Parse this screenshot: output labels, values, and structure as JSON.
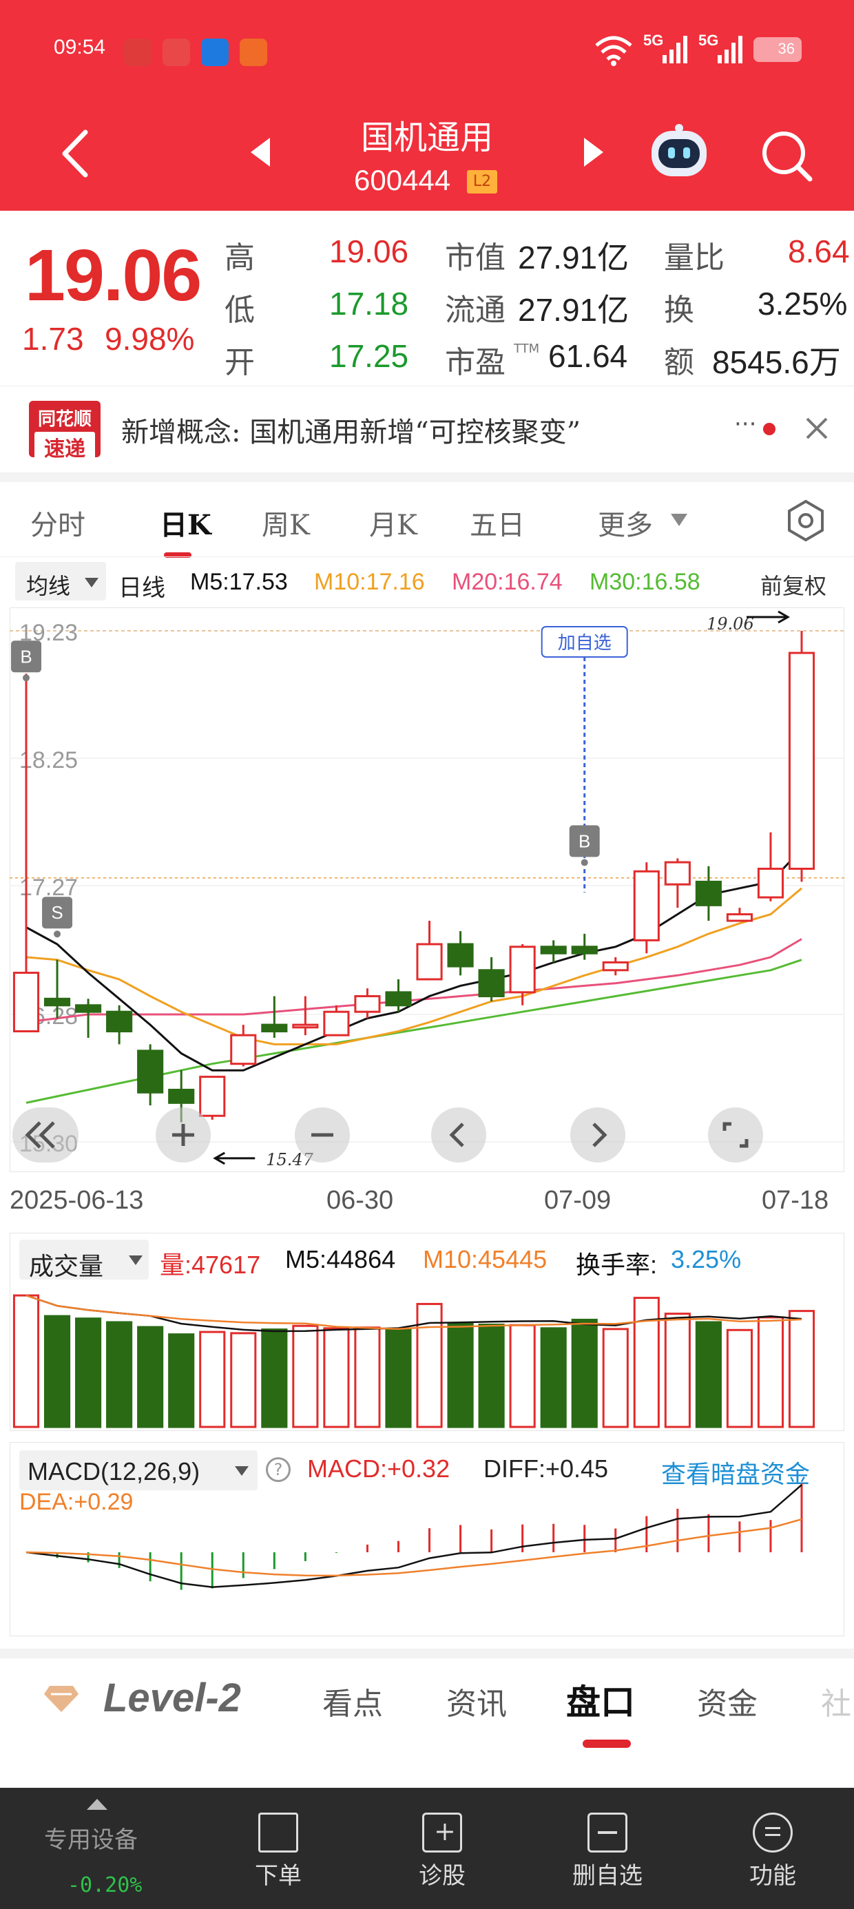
{
  "status_bar": {
    "time": "09:54",
    "network_1": "5G",
    "network_2": "5G",
    "battery": "36"
  },
  "header": {
    "title": "国机通用",
    "code": "600444",
    "level_badge": "L2"
  },
  "quote": {
    "price": "19.06",
    "change": "1.73",
    "change_pct": "9.98%",
    "high_label": "高",
    "high": "19.06",
    "low_label": "低",
    "low": "17.18",
    "open_label": "开",
    "open": "17.25",
    "mkt_cap_label": "市值",
    "mkt_cap": "27.91亿",
    "float_cap_label": "流通",
    "float_cap": "27.91亿",
    "pe_label": "市盈",
    "pe_sup": "TTM",
    "pe": "61.64",
    "vol_ratio_label": "量比",
    "vol_ratio": "8.64",
    "turnover_label": "换",
    "turnover": "3.25%",
    "amount_label": "额",
    "amount": "8545.6万"
  },
  "news": {
    "logo_line1": "同花顺",
    "logo_line2": "速递",
    "text": "新增概念:  国机通用新增“可控核聚变”",
    "more": "···"
  },
  "tabs": [
    "分时",
    "日K",
    "周K",
    "月K",
    "五日",
    "更多"
  ],
  "active_tab": "日K",
  "indicators": {
    "ma_select": "均线",
    "period": "日线",
    "m5": "M5:17.53",
    "m10": "M10:17.16",
    "m20": "M20:16.74",
    "m30": "M30:16.58",
    "adjust": "前复权"
  },
  "chart_data": {
    "type": "candlestick",
    "y_labels": [
      "19.23",
      "18.25",
      "17.27",
      "16.28",
      "15.30"
    ],
    "ylim": [
      15.3,
      19.23
    ],
    "x_labels": [
      "2025-06-13",
      "06-30",
      "07-09",
      "07-18"
    ],
    "candles": [
      {
        "o": 16.15,
        "h": 18.9,
        "l": 16.15,
        "c": 16.6,
        "v": 54000
      },
      {
        "o": 16.4,
        "h": 16.7,
        "l": 16.25,
        "c": 16.35,
        "v": 45500
      },
      {
        "o": 16.35,
        "h": 16.4,
        "l": 16.1,
        "c": 16.3,
        "v": 44500
      },
      {
        "o": 16.3,
        "h": 16.35,
        "l": 16.05,
        "c": 16.15,
        "v": 43000
      },
      {
        "o": 16.0,
        "h": 16.05,
        "l": 15.58,
        "c": 15.68,
        "v": 41000
      },
      {
        "o": 15.7,
        "h": 15.85,
        "l": 15.45,
        "c": 15.6,
        "v": 38000
      },
      {
        "o": 15.5,
        "h": 15.8,
        "l": 15.47,
        "c": 15.8,
        "v": 39000
      },
      {
        "o": 15.9,
        "h": 16.2,
        "l": 15.88,
        "c": 16.12,
        "v": 38500
      },
      {
        "o": 16.2,
        "h": 16.42,
        "l": 16.1,
        "c": 16.15,
        "v": 40000
      },
      {
        "o": 16.18,
        "h": 16.42,
        "l": 16.12,
        "c": 16.2,
        "v": 41500
      },
      {
        "o": 16.12,
        "h": 16.35,
        "l": 16.12,
        "c": 16.3,
        "v": 40500
      },
      {
        "o": 16.3,
        "h": 16.48,
        "l": 16.25,
        "c": 16.42,
        "v": 40800
      },
      {
        "o": 16.45,
        "h": 16.55,
        "l": 16.3,
        "c": 16.35,
        "v": 40200
      },
      {
        "o": 16.55,
        "h": 17.0,
        "l": 16.55,
        "c": 16.82,
        "v": 50500
      },
      {
        "o": 16.82,
        "h": 16.92,
        "l": 16.58,
        "c": 16.65,
        "v": 42500
      },
      {
        "o": 16.62,
        "h": 16.72,
        "l": 16.38,
        "c": 16.42,
        "v": 42000
      },
      {
        "o": 16.45,
        "h": 16.82,
        "l": 16.35,
        "c": 16.8,
        "v": 41800
      },
      {
        "o": 16.8,
        "h": 16.85,
        "l": 16.68,
        "c": 16.75,
        "v": 40500
      },
      {
        "o": 16.8,
        "h": 16.9,
        "l": 16.7,
        "c": 16.75,
        "v": 44000
      },
      {
        "o": 16.62,
        "h": 16.72,
        "l": 16.58,
        "c": 16.68,
        "v": 40200
      },
      {
        "o": 16.85,
        "h": 17.45,
        "l": 16.75,
        "c": 17.38,
        "v": 53000
      },
      {
        "o": 17.28,
        "h": 17.48,
        "l": 17.1,
        "c": 17.45,
        "v": 46500
      },
      {
        "o": 17.3,
        "h": 17.42,
        "l": 17.0,
        "c": 17.12,
        "v": 43000
      },
      {
        "o": 17.0,
        "h": 17.1,
        "l": 17.0,
        "c": 17.05,
        "v": 39800
      },
      {
        "o": 17.18,
        "h": 17.68,
        "l": 17.15,
        "c": 17.4,
        "v": 45000
      },
      {
        "o": 17.4,
        "h": 19.23,
        "l": 17.3,
        "c": 19.06,
        "v": 47617
      }
    ],
    "ma5": [
      16.95,
      16.82,
      16.6,
      16.4,
      16.2,
      15.98,
      15.85,
      15.85,
      15.95,
      16.05,
      16.15,
      16.25,
      16.3,
      16.42,
      16.5,
      16.55,
      16.6,
      16.68,
      16.75,
      16.8,
      16.9,
      17.05,
      17.2,
      17.25,
      17.3,
      17.55
    ],
    "ma10": [
      16.72,
      16.7,
      16.62,
      16.55,
      16.42,
      16.3,
      16.2,
      16.1,
      16.05,
      16.05,
      16.05,
      16.1,
      16.15,
      16.22,
      16.3,
      16.38,
      16.42,
      16.5,
      16.58,
      16.65,
      16.72,
      16.8,
      16.9,
      16.98,
      17.05,
      17.25
    ],
    "ma20": [
      16.22,
      16.25,
      16.28,
      16.28,
      16.28,
      16.28,
      16.28,
      16.28,
      16.3,
      16.32,
      16.34,
      16.36,
      16.38,
      16.4,
      16.42,
      16.44,
      16.46,
      16.48,
      16.5,
      16.52,
      16.55,
      16.58,
      16.62,
      16.66,
      16.72,
      16.86
    ],
    "ma30": [
      15.6,
      15.65,
      15.7,
      15.75,
      15.8,
      15.85,
      15.9,
      15.94,
      15.98,
      16.02,
      16.06,
      16.1,
      16.14,
      16.18,
      16.22,
      16.26,
      16.3,
      16.34,
      16.38,
      16.42,
      16.46,
      16.5,
      16.54,
      16.58,
      16.62,
      16.7
    ],
    "high_marker": "19.06",
    "low_marker": "15.47",
    "add_watch_label": "加自选",
    "buy_marker": "B",
    "sell_marker": "S"
  },
  "volume": {
    "label": "成交量",
    "vol": "量:47617",
    "m5": "M5:44864",
    "m10": "M10:45445",
    "turnover_label": "换手率:",
    "turnover": "3.25%"
  },
  "macd": {
    "label": "MACD(12,26,9)",
    "macd": "MACD:+0.32",
    "diff": "DIFF:+0.45",
    "dea": "DEA:+0.29",
    "link": "查看暗盘资金",
    "help": "?"
  },
  "bottom_tabs": {
    "level2": "Level-2",
    "items": [
      "看点",
      "资讯",
      "盘口",
      "资金",
      "社"
    ],
    "active": "盘口"
  },
  "nav": {
    "device_label": "专用设备",
    "device_change": "-0.20%",
    "items": [
      "下单",
      "诊股",
      "删自选",
      "功能"
    ]
  },
  "colors": {
    "brand_red": "#f0303c",
    "up_red": "#e22b2b",
    "down_green": "#2a6a15",
    "ma5": "#111111",
    "ma10": "#f0a020",
    "ma20": "#e8507a",
    "ma30": "#55bb33"
  }
}
